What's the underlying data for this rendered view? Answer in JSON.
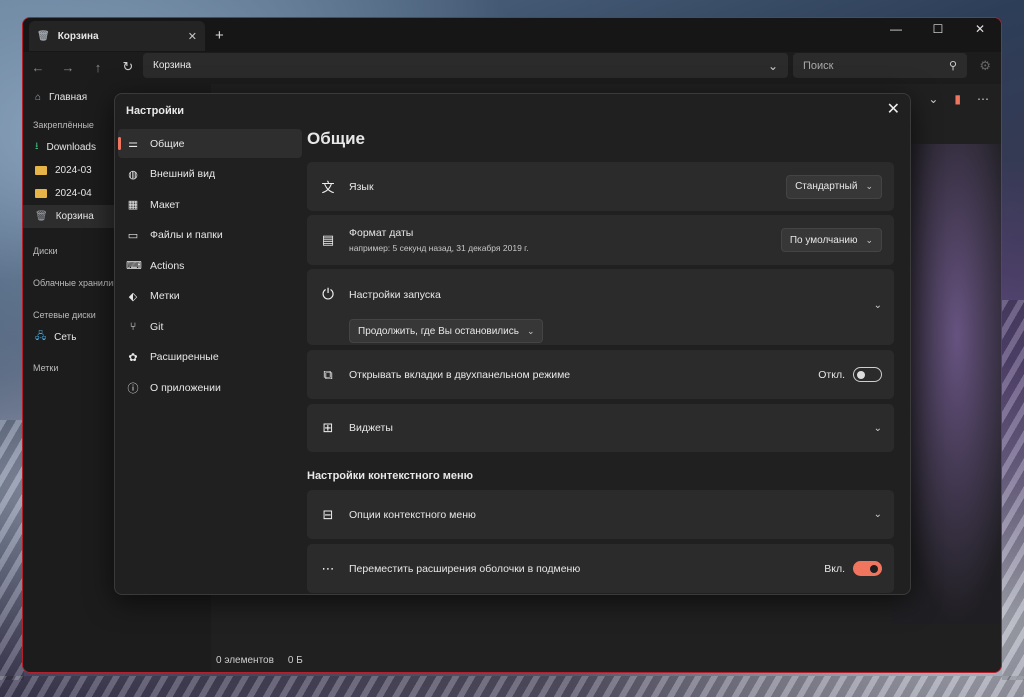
{
  "window": {
    "tab_title": "Корзина",
    "new_tab": "+",
    "address": "Корзина",
    "search_placeholder": "Поиск"
  },
  "sidebar": {
    "home": "Главная",
    "pinned_header": "Закреплённые",
    "pinned": [
      "Downloads",
      "2024-03",
      "2024-04",
      "Корзина"
    ],
    "drives_header": "Диски",
    "cloud_header": "Облачные хранилища",
    "network_header": "Сетевые диски",
    "network_item": "Сеть",
    "tags_header": "Метки"
  },
  "status": {
    "items": "0 элементов",
    "size": "0 Б"
  },
  "settings": {
    "title": "Настройки",
    "nav": [
      "Общие",
      "Внешний вид",
      "Макет",
      "Файлы и папки",
      "Actions",
      "Метки",
      "Git",
      "Расширенные",
      "О приложении"
    ],
    "page_title": "Общие",
    "language": {
      "label": "Язык",
      "value": "Стандартный"
    },
    "date_format": {
      "label": "Формат даты",
      "example": "например: 5 секунд назад, 31 декабря 2019 г.",
      "value": "По умолчанию"
    },
    "startup": {
      "label": "Настройки запуска",
      "value": "Продолжить, где Вы остановились"
    },
    "dual_pane": {
      "label": "Открывать вкладки в двухпанельном режиме",
      "state": "Откл."
    },
    "widgets": {
      "label": "Виджеты"
    },
    "context_header": "Настройки контекстного меню",
    "context_options": {
      "label": "Опции контекстного меню"
    },
    "shell_ext": {
      "label": "Переместить расширения оболочки в подменю",
      "state": "Вкл."
    }
  },
  "colors": {
    "accent": "#f0755f",
    "window_border": "#b3202c"
  }
}
